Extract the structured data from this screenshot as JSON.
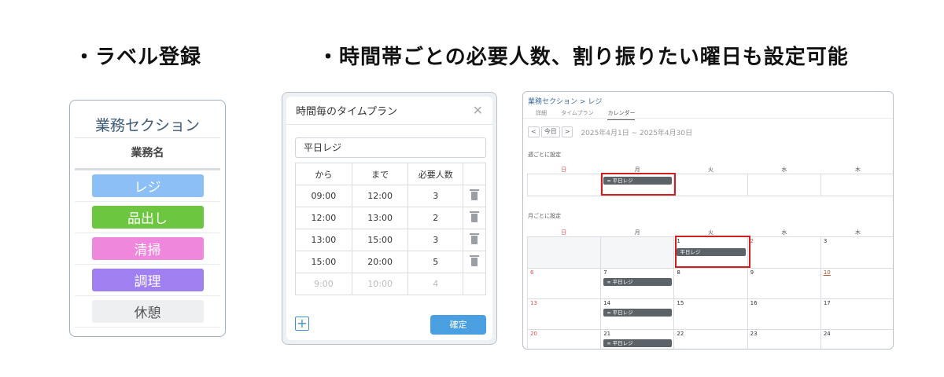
{
  "headlines": {
    "labels": "・ラベル登録",
    "timeplan": "・時間帯ごとの必要人数、割り振りたい曜日も設定可能"
  },
  "label_panel": {
    "title": "業務セクション",
    "column_header": "業務名",
    "items": [
      {
        "label": "レジ",
        "color": "#8cbff5"
      },
      {
        "label": "品出し",
        "color": "#6cc63f"
      },
      {
        "label": "清掃",
        "color": "#ef87dd"
      },
      {
        "label": "調理",
        "color": "#a07ff0"
      },
      {
        "label": "休憩",
        "color": "#eeeff1",
        "text_color": "#555555"
      }
    ]
  },
  "timeplan_modal": {
    "title": "時間毎のタイムプラン",
    "close_icon": "close-icon",
    "name_value": "平日レジ",
    "columns": [
      "から",
      "まで",
      "必要人数"
    ],
    "rows": [
      {
        "from": "09:00",
        "to": "12:00",
        "count": "3"
      },
      {
        "from": "12:00",
        "to": "13:00",
        "count": "2"
      },
      {
        "from": "13:00",
        "to": "15:00",
        "count": "3"
      },
      {
        "from": "15:00",
        "to": "20:00",
        "count": "5"
      }
    ],
    "placeholder_row": {
      "from": "9:00",
      "to": "10:00",
      "count": "4"
    },
    "add_label": "+",
    "confirm_label": "確定",
    "accent_color": "#4a9fe0"
  },
  "calendar": {
    "breadcrumb_parent": "業務セクション",
    "breadcrumb_sep": ">",
    "breadcrumb_current": "レジ",
    "tabs": [
      "詳細",
      "タイムプラン",
      "カレンダー"
    ],
    "active_tab": "カレンダー",
    "nav_prev": "<",
    "nav_today": "今日",
    "nav_next": ">",
    "range": "2025年4月1日 ~ 2025年4月30日",
    "weekly_title": "週ごとに設定",
    "monthly_title": "月ごとに設定",
    "weekdays": [
      "日",
      "月",
      "火",
      "水",
      "木"
    ],
    "weekly_event": "∞  平日レジ",
    "monthly_event_first": "平日レジ",
    "monthly_event": "∞  平日レジ",
    "weeks": [
      [
        "",
        "",
        "1",
        "2",
        "3"
      ],
      [
        "6",
        "7",
        "8",
        "9",
        "10"
      ],
      [
        "13",
        "14",
        "15",
        "16",
        "17"
      ],
      [
        "20",
        "21",
        "22",
        "23",
        "24"
      ]
    ],
    "highlight_color": "#d11f1f"
  }
}
